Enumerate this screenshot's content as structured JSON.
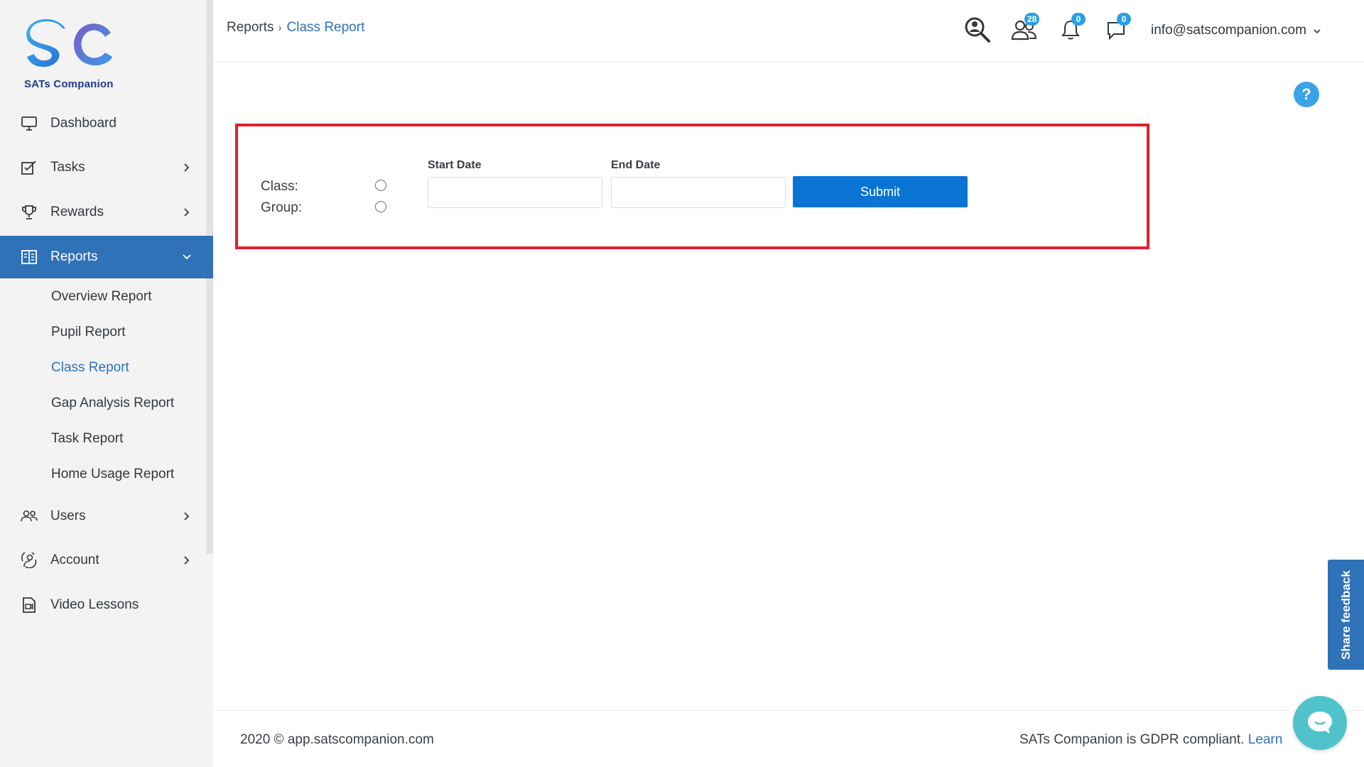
{
  "brand": {
    "logo_letters": "SC",
    "name": "SATs Companion"
  },
  "sidebar": {
    "items": [
      {
        "label": "Dashboard",
        "icon": "monitor-icon"
      },
      {
        "label": "Tasks",
        "icon": "tasks-icon"
      },
      {
        "label": "Rewards",
        "icon": "trophy-icon"
      },
      {
        "label": "Reports",
        "icon": "reports-icon",
        "active": true
      },
      {
        "label": "Users",
        "icon": "users-icon"
      },
      {
        "label": "Account",
        "icon": "account-icon"
      },
      {
        "label": "Video Lessons",
        "icon": "video-icon"
      }
    ],
    "reports_sub": [
      "Overview Report",
      "Pupil Report",
      "Class Report",
      "Gap Analysis Report",
      "Task Report",
      "Home Usage Report"
    ]
  },
  "header": {
    "breadcrumb_root": "Reports",
    "breadcrumb_sep": "›",
    "breadcrumb_current": "Class Report",
    "users_badge": "28",
    "notifications_badge": "0",
    "messages_badge": "0",
    "user_email": "info@satscompanion.com"
  },
  "form": {
    "class_label": "Class:",
    "group_label": "Group:",
    "start_date_label": "Start Date",
    "start_date_value": "",
    "end_date_label": "End Date",
    "end_date_value": "",
    "submit_label": "Submit"
  },
  "help": {
    "label": "?"
  },
  "footer": {
    "copyright": "2020 © app.satscompanion.com",
    "gdpr_text": "SATs Companion is GDPR compliant.",
    "learn_more": "Learn"
  },
  "feedback": {
    "label": "Share feedback"
  },
  "colors": {
    "accent": "#2f72b8",
    "submit": "#0a74d4",
    "highlight_border": "#e1202a",
    "badge": "#2aa0e3",
    "chat": "#4fc3c9"
  }
}
